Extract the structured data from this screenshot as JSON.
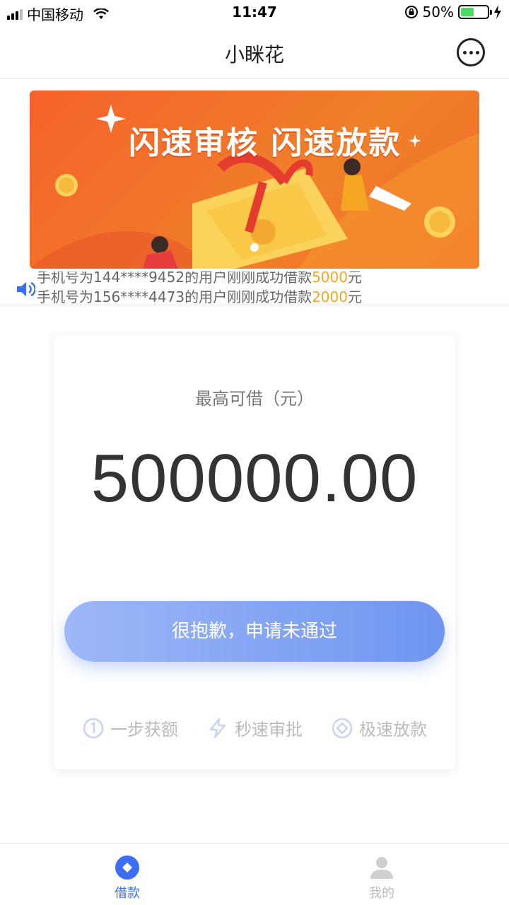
{
  "status_bar": {
    "carrier": "中国移动",
    "time": "11:47",
    "battery": "50%",
    "battery_level": 0.5
  },
  "nav": {
    "title": "小眯花"
  },
  "banner": {
    "headline": "闪速审核 闪速放款"
  },
  "ticker": {
    "line1_a": "手机号为144****9452的用户刚刚成功借款",
    "line1_amount": "5000",
    "line1_b": "元",
    "line2_a": "手机号为156****4473的用户刚刚成功借款",
    "line2_amount": "2000",
    "line2_b": "元"
  },
  "card": {
    "label": "最高可借（元）",
    "amount": "500000.00",
    "button_label": "很抱歉，申请未通过",
    "features": [
      {
        "label": "一步获额",
        "icon": "step-one-icon"
      },
      {
        "label": "秒速审批",
        "icon": "lightning-icon"
      },
      {
        "label": "极速放款",
        "icon": "coin-icon"
      }
    ]
  },
  "tabs": [
    {
      "label": "借款",
      "icon": "borrow-icon",
      "active": true
    },
    {
      "label": "我的",
      "icon": "user-icon",
      "active": false
    }
  ],
  "colors": {
    "accent": "#3b6ef5",
    "button_start": "#9db8f8",
    "button_end": "#6f95f0",
    "banner": "#f5612b",
    "highlight": "#f5a623"
  }
}
